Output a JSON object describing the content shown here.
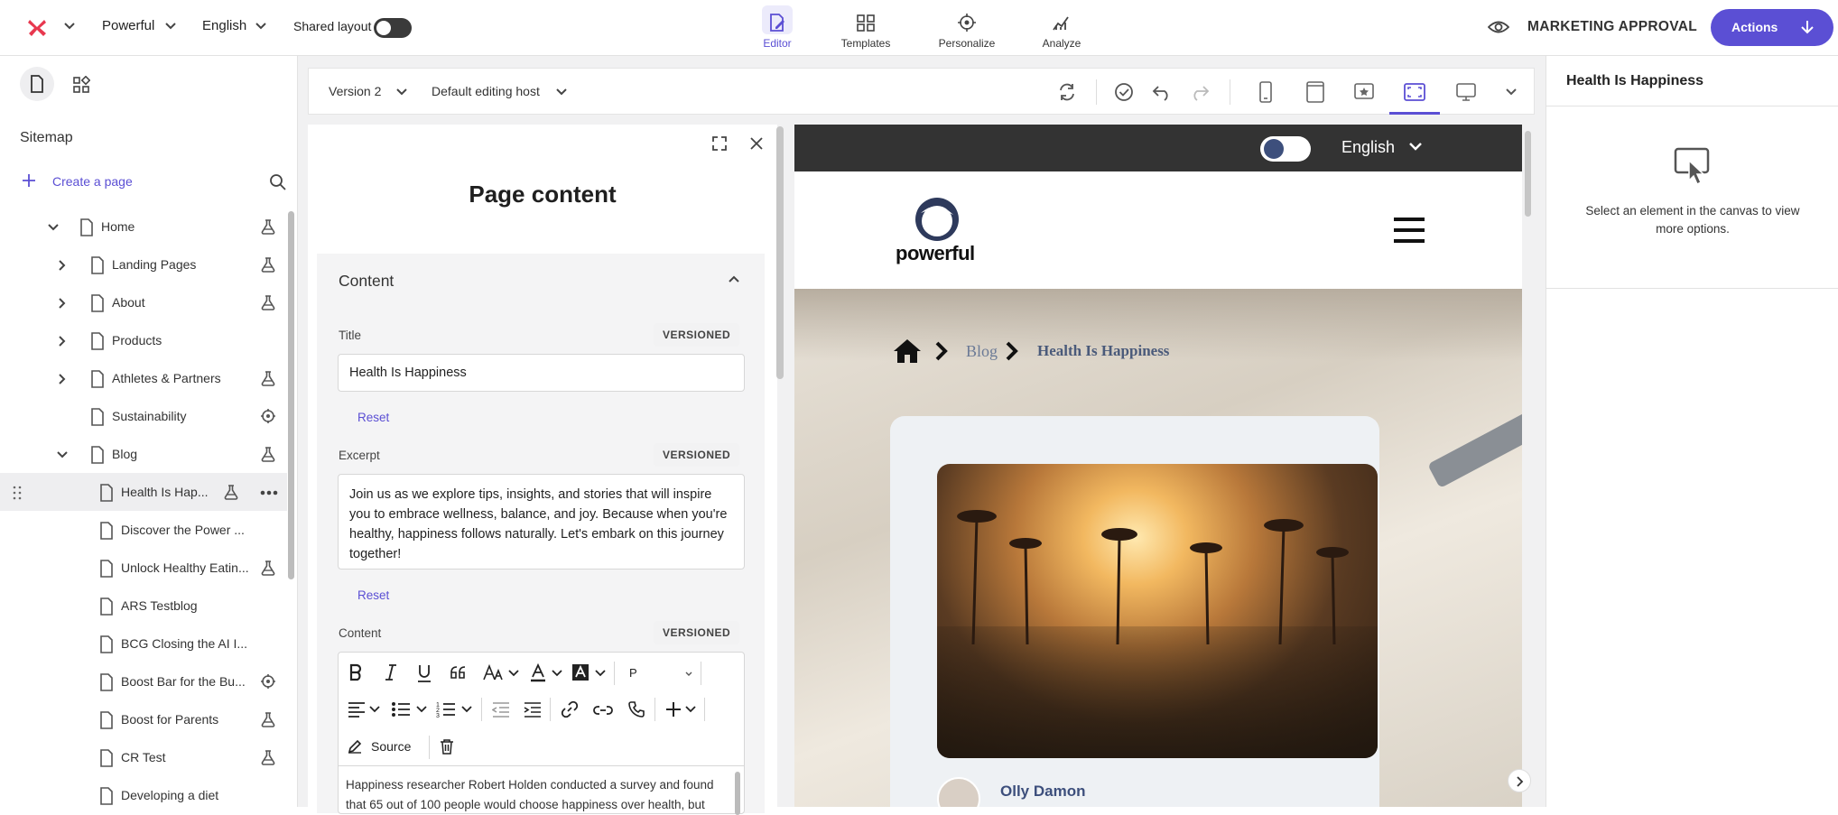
{
  "topbar": {
    "site_name": "Powerful",
    "language": "English",
    "shared_layout_label": "Shared layout",
    "shared_layout_on": false,
    "tabs": [
      {
        "label": "Editor",
        "icon": "editor-icon",
        "active": true
      },
      {
        "label": "Templates",
        "icon": "templates-icon",
        "active": false
      },
      {
        "label": "Personalize",
        "icon": "personalize-icon",
        "active": false
      },
      {
        "label": "Analyze",
        "icon": "analyze-icon",
        "active": false
      }
    ],
    "workflow_state": "MARKETING APPROVAL",
    "actions_label": "Actions",
    "accent_color": "#5b4fd4"
  },
  "sidebar": {
    "section_title": "Sitemap",
    "create_page_label": "Create a page",
    "items": [
      {
        "label": "Home",
        "expand": "expanded",
        "status": "flask-icon"
      },
      {
        "label": "Landing Pages",
        "expand": "collapsed",
        "status": "flask-icon"
      },
      {
        "label": "About",
        "expand": "collapsed",
        "status": "flask-icon"
      },
      {
        "label": "Products",
        "expand": "collapsed",
        "status": ""
      },
      {
        "label": "Athletes & Partners",
        "expand": "collapsed",
        "status": "flask-icon"
      },
      {
        "label": "Sustainability",
        "expand": "none",
        "status": "target-icon"
      },
      {
        "label": "Blog",
        "expand": "expanded",
        "status": "flask-icon"
      },
      {
        "label": "Health Is Hap...",
        "expand": "none",
        "status": "flask-icon",
        "selected": true
      },
      {
        "label": "Discover the Power ...",
        "expand": "none",
        "status": ""
      },
      {
        "label": "Unlock Healthy Eatin...",
        "expand": "none",
        "status": "flask-icon"
      },
      {
        "label": "ARS Testblog",
        "expand": "none",
        "status": ""
      },
      {
        "label": "BCG Closing the AI I...",
        "expand": "none",
        "status": ""
      },
      {
        "label": "Boost Bar for the Bu...",
        "expand": "none",
        "status": "target-icon"
      },
      {
        "label": "Boost for Parents",
        "expand": "none",
        "status": "flask-icon"
      },
      {
        "label": "CR Test",
        "expand": "none",
        "status": "flask-icon"
      },
      {
        "label": "Developing a diet",
        "expand": "none",
        "status": ""
      }
    ]
  },
  "editor_toolbar": {
    "version_label": "Version 2",
    "host_label": "Default editing host"
  },
  "content_panel": {
    "heading": "Page content",
    "section_title": "Content",
    "title_label": "Title",
    "title_value": "Health Is Happiness",
    "excerpt_label": "Excerpt",
    "excerpt_value": "Join us as we explore tips, insights, and stories that will inspire you to embrace wellness, balance, and joy. Because when you're healthy, happiness follows naturally. Let's embark on this journey together!",
    "content_label": "Content",
    "versioned_badge": "VERSIONED",
    "reset_label": "Reset",
    "paragraph_style": "P",
    "source_label": "Source",
    "content_preview": "Happiness researcher Robert Holden conducted a survey and found that 65 out of 100 people would choose happiness over health, but"
  },
  "canvas": {
    "language": "English",
    "brand_name": "powerful",
    "breadcrumb_blog": "Blog",
    "breadcrumb_current": "Health Is Happiness",
    "author_name": "Olly Damon"
  },
  "right_panel": {
    "title": "Health Is Happiness",
    "hint": "Select an element in the canvas to view more options."
  }
}
